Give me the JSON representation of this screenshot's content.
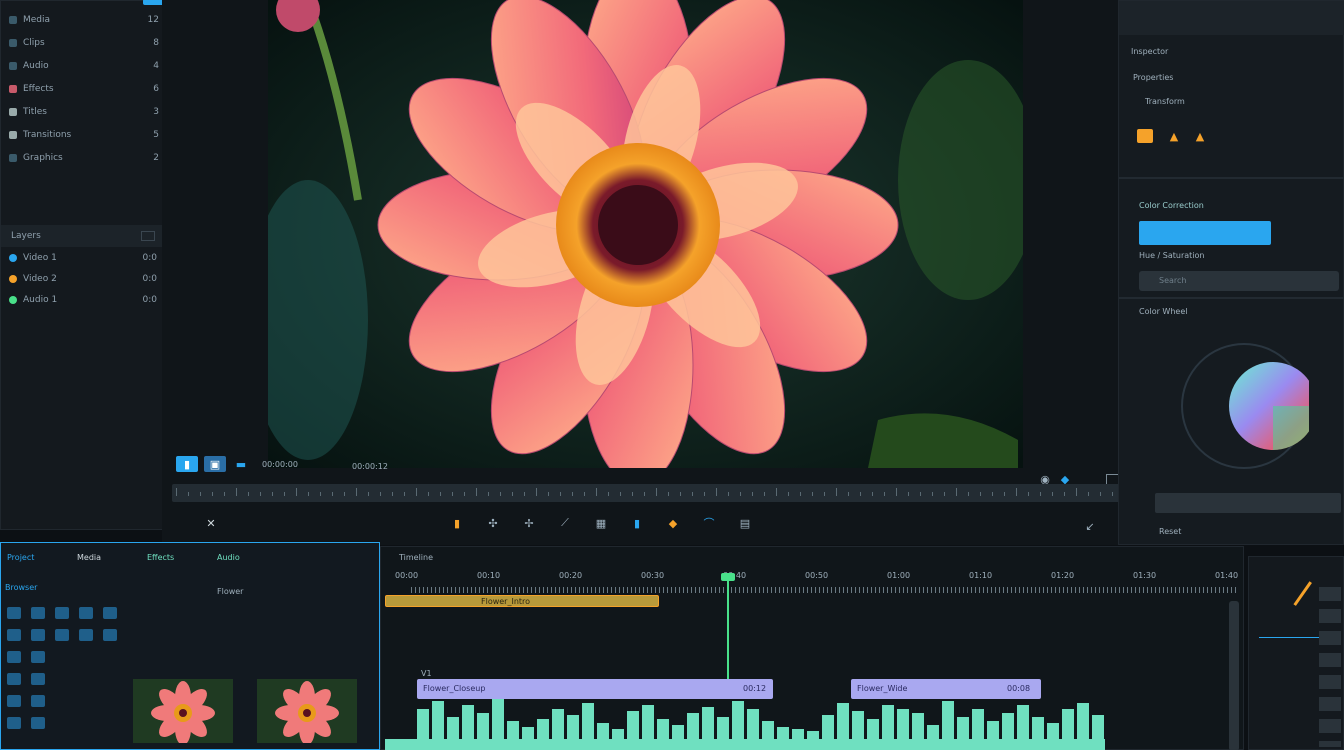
{
  "left_panel": {
    "items": [
      {
        "label": "Media",
        "count": "12"
      },
      {
        "label": "Clips",
        "count": "8"
      },
      {
        "label": "Audio",
        "count": "4"
      },
      {
        "label": "Effects",
        "count": "6"
      },
      {
        "label": "Titles",
        "count": "3"
      },
      {
        "label": "Transitions",
        "count": "5"
      },
      {
        "label": "Graphics",
        "count": "2"
      }
    ],
    "section_title": "Layers",
    "layers": [
      {
        "label": "Video 1",
        "value": "0:0"
      },
      {
        "label": "Video 2",
        "value": "0:0"
      },
      {
        "label": "Audio 1",
        "value": "0:0"
      }
    ]
  },
  "viewer": {
    "timecode_left": "00:00:00",
    "timecode_mid": "00:00:12",
    "tools": [
      "pointer-icon",
      "razor-icon",
      "pen-icon",
      "slip-icon",
      "crop-icon",
      "marker-icon",
      "fx-icon",
      "color-icon",
      "audio-icon",
      "export-icon"
    ]
  },
  "right_panel": {
    "title": "Inspector",
    "subtitle": "Properties",
    "row_label": "Transform",
    "selected_label": "Color Correction",
    "sub_label": "Hue / Saturation",
    "search_placeholder": "Search",
    "wheel_label": "Color Wheel",
    "footer_label": "Reset"
  },
  "bottom_left": {
    "tabs": [
      "Project",
      "Media",
      "Effects",
      "Audio"
    ],
    "browser_title": "Browser",
    "thumb_label": "Flower",
    "thumbs": [
      "flower-clip-1",
      "flower-clip-2"
    ]
  },
  "timeline": {
    "title": "Timeline",
    "ruler": [
      "00:00",
      "00:10",
      "00:20",
      "00:30",
      "00:40",
      "00:50",
      "01:00",
      "01:10",
      "01:20",
      "01:30",
      "01:40"
    ],
    "clip_top": "Flower_Intro",
    "clip_mid": "Flower_Closeup",
    "clip_mid2": "Flower_Wide",
    "track_label": "V1",
    "clip_label_a": "00:12",
    "clip_label_b": "00:08"
  },
  "colors": {
    "accent_blue": "#2aa6ef",
    "accent_teal": "#6fe0c0",
    "accent_orange": "#f5a22a",
    "clip_purple": "#a9a8f0",
    "playhead": "#49e08a"
  }
}
